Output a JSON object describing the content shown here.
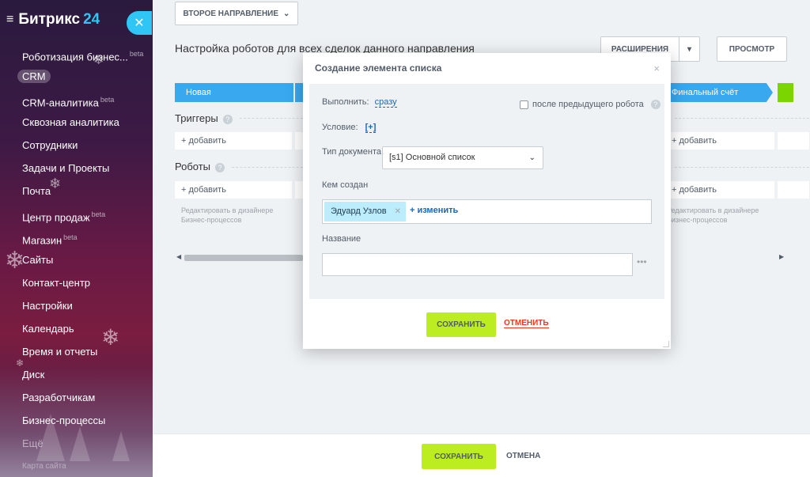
{
  "sidebar": {
    "logo_text": "Битрикс",
    "logo_num": "24",
    "items": [
      {
        "label": "Роботизация бизнес...",
        "beta": "beta"
      },
      {
        "label": "CRM",
        "beta": ""
      },
      {
        "label": "CRM-аналитика",
        "beta": "beta"
      },
      {
        "label": "Сквозная аналитика",
        "beta": ""
      },
      {
        "label": "Сотрудники",
        "beta": ""
      },
      {
        "label": "Задачи и Проекты",
        "beta": ""
      },
      {
        "label": "Почта",
        "beta": ""
      },
      {
        "label": "Центр продаж",
        "beta": "beta"
      },
      {
        "label": "Магазин",
        "beta": "beta"
      },
      {
        "label": "Сайты",
        "beta": ""
      },
      {
        "label": "Контакт-центр",
        "beta": ""
      },
      {
        "label": "Настройки",
        "beta": ""
      },
      {
        "label": "Календарь",
        "beta": ""
      },
      {
        "label": "Время и отчеты",
        "beta": ""
      },
      {
        "label": "Диск",
        "beta": ""
      },
      {
        "label": "Разработчикам",
        "beta": ""
      },
      {
        "label": "Бизнес-процессы",
        "beta": ""
      },
      {
        "label": "Ещё",
        "beta": ""
      },
      {
        "label": "Карта сайта",
        "beta": ""
      }
    ]
  },
  "header": {
    "direction_dropdown": "ВТОРОЕ НАПРАВЛЕНИЕ",
    "page_title": "Настройка роботов для всех сделок данного направления",
    "extensions_label": "РАСШИРЕНИЯ",
    "preview_label": "ПРОСМОТР"
  },
  "stages": {
    "new": "Новая",
    "final": "Финальный счёт"
  },
  "sections": {
    "triggers_title": "Триггеры",
    "robots_title": "Роботы",
    "add_label": "+ добавить",
    "hint_line1": "Редактировать в дизайнере",
    "hint_line2": "Бизнес-процессов",
    "hint_right_line1": "Редактировать в дизайнере",
    "hint_right_line2": "Бизнес-процессов"
  },
  "dialog": {
    "title": "Создание элемента списка",
    "execute_label": "Выполнить:",
    "execute_value": "сразу",
    "after_prev_label": "после предыдущего робота",
    "condition_label": "Условие:",
    "condition_value": "[+]",
    "doc_type_label": "Тип документа:",
    "doc_type_value": "[s1] Основной список",
    "created_by_label": "Кем создан",
    "creator_tag": "Эдуард Узлов",
    "change_link": "+ изменить",
    "name_label": "Название",
    "name_value": "",
    "save_label": "СОХРАНИТЬ",
    "cancel_label": "ОТМЕНИТЬ"
  },
  "footer": {
    "save_label": "СОХРАНИТЬ",
    "cancel_label": "ОТМЕНА"
  },
  "colors": {
    "accent": "#2fc6f6",
    "stage_blue": "#39a8ef",
    "save_green": "#bbed21",
    "cancel_red": "#f0371b"
  }
}
